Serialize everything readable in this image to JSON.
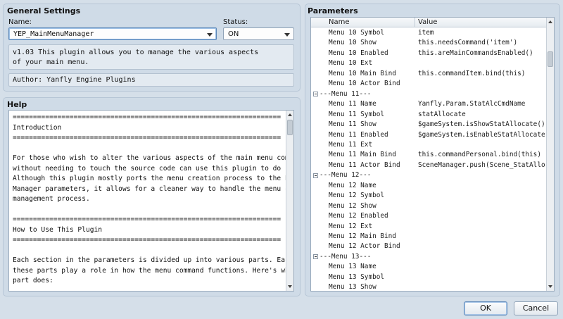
{
  "general": {
    "title": "General Settings",
    "name_label": "Name:",
    "name_value": "YEP_MainMenuManager",
    "status_label": "Status:",
    "status_value": "ON",
    "description": "v1.03 This plugin allows you to manage the various aspects\nof your main menu.",
    "author": "Author: Yanfly Engine Plugins"
  },
  "help": {
    "title": "Help",
    "text": "==================================================================\nIntroduction\n==================================================================\n\nFor those who wish to alter the various aspects of the main menu commands\nwithout needing to touch the source code can use this plugin to do so.\nAlthough this plugin mostly ports the menu creation process to the Plugin\nManager parameters, it allows for a cleaner way to handle the menu command\nmanagement process.\n\n==================================================================\nHow to Use This Plugin\n==================================================================\n\nEach section in the parameters is divided up into various parts. Each of\nthese parts play a role in how the menu command functions. Here's what each\npart does:"
  },
  "parameters": {
    "title": "Parameters",
    "col_name": "Name",
    "col_value": "Value",
    "rows": [
      {
        "name": "Menu 10 Symbol",
        "value": "item"
      },
      {
        "name": "Menu 10 Show",
        "value": "this.needsCommand('item')"
      },
      {
        "name": "Menu 10 Enabled",
        "value": "this.areMainCommandsEnabled()"
      },
      {
        "name": "Menu 10 Ext",
        "value": ""
      },
      {
        "name": "Menu 10 Main Bind",
        "value": "this.commandItem.bind(this)"
      },
      {
        "name": "Menu 10 Actor Bind",
        "value": ""
      },
      {
        "name": "---Menu 11---",
        "value": "",
        "group": true
      },
      {
        "name": "Menu 11 Name",
        "value": "Yanfly.Param.StatAlcCmdName"
      },
      {
        "name": "Menu 11 Symbol",
        "value": "statAllocate"
      },
      {
        "name": "Menu 11 Show",
        "value": "$gameSystem.isShowStatAllocate()"
      },
      {
        "name": "Menu 11 Enabled",
        "value": "$gameSystem.isEnableStatAllocate()"
      },
      {
        "name": "Menu 11 Ext",
        "value": ""
      },
      {
        "name": "Menu 11 Main Bind",
        "value": "this.commandPersonal.bind(this)"
      },
      {
        "name": "Menu 11 Actor Bind",
        "value": "SceneManager.push(Scene_StatAlloca…"
      },
      {
        "name": "---Menu 12---",
        "value": "",
        "group": true
      },
      {
        "name": "Menu 12 Name",
        "value": ""
      },
      {
        "name": "Menu 12 Symbol",
        "value": ""
      },
      {
        "name": "Menu 12 Show",
        "value": ""
      },
      {
        "name": "Menu 12 Enabled",
        "value": ""
      },
      {
        "name": "Menu 12 Ext",
        "value": ""
      },
      {
        "name": "Menu 12 Main Bind",
        "value": ""
      },
      {
        "name": "Menu 12 Actor Bind",
        "value": ""
      },
      {
        "name": "---Menu 13---",
        "value": "",
        "group": true
      },
      {
        "name": "Menu 13 Name",
        "value": ""
      },
      {
        "name": "Menu 13 Symbol",
        "value": ""
      },
      {
        "name": "Menu 13 Show",
        "value": ""
      }
    ]
  },
  "footer": {
    "ok_label": "OK",
    "cancel_label": "Cancel"
  },
  "icons": {
    "combo_arrow": "chevron-down-icon",
    "expander": "collapse-icon"
  }
}
